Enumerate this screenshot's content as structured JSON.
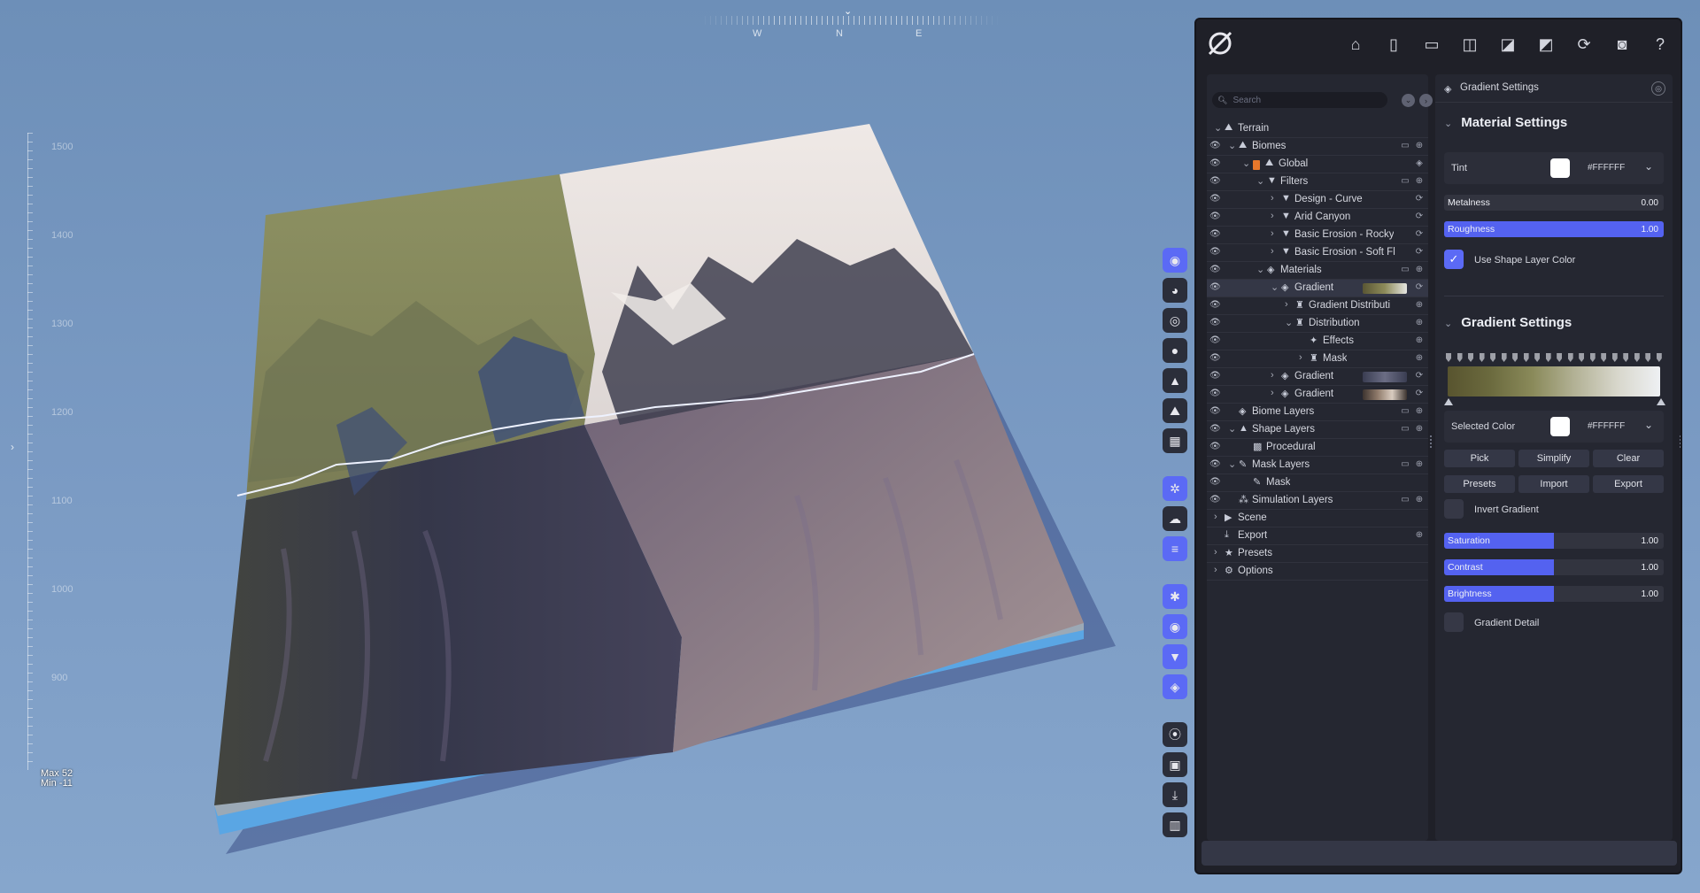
{
  "viewport": {
    "compass": {
      "pointer": "⌄",
      "west": "W",
      "north": "N",
      "east": "E"
    },
    "ruler": {
      "labels": [
        "1500",
        "1400",
        "1300",
        "1200",
        "1100",
        "1000",
        "900"
      ],
      "max_text": "Max 52",
      "min_text": "Min -11"
    },
    "left_handle": "›",
    "colors": {
      "sky": "#7b9bc4",
      "snow": "#ece7e4",
      "grass": "#8f9262",
      "rock_shadow": "#3a3b4c",
      "water_edge": "#5aa6e4"
    }
  },
  "vtoolbar": {
    "items": [
      {
        "name": "profile-icon",
        "glyph": "◉",
        "accent": true
      },
      {
        "name": "globe-icon",
        "glyph": "◕",
        "accent": false
      },
      {
        "name": "target-icon",
        "glyph": "◎",
        "accent": false
      },
      {
        "name": "water-drop-icon",
        "glyph": "●",
        "accent": false
      },
      {
        "name": "mountain-icon",
        "glyph": "▲",
        "accent": false
      },
      {
        "name": "landscape-icon",
        "glyph": "⛰",
        "accent": false
      },
      {
        "name": "grid-icon",
        "glyph": "▦",
        "accent": false
      },
      {
        "name": "snowflake-icon",
        "glyph": "✲",
        "accent": true
      },
      {
        "name": "cloud-icon",
        "glyph": "☁",
        "accent": false
      },
      {
        "name": "lines-icon",
        "glyph": "≡",
        "accent": true
      },
      {
        "name": "settings-sliders-icon",
        "glyph": "✱",
        "accent": true
      },
      {
        "name": "eye-icon",
        "glyph": "◉",
        "accent": true
      },
      {
        "name": "filter-icon",
        "glyph": "▼",
        "accent": true
      },
      {
        "name": "layers-icon",
        "glyph": "◈",
        "accent": true
      },
      {
        "name": "record-icon",
        "glyph": "⦿",
        "accent": false
      },
      {
        "name": "image-icon",
        "glyph": "▣",
        "accent": false
      },
      {
        "name": "download-icon",
        "glyph": "⤓",
        "accent": false
      },
      {
        "name": "stats-icon",
        "glyph": "▥",
        "accent": false
      }
    ]
  },
  "toolbar": {
    "icons": [
      {
        "name": "home-icon",
        "glyph": "⌂"
      },
      {
        "name": "new-file-icon",
        "glyph": "▯"
      },
      {
        "name": "open-folder-icon",
        "glyph": "▭"
      },
      {
        "name": "save-icon",
        "glyph": "◫"
      },
      {
        "name": "save-as-icon",
        "glyph": "◪"
      },
      {
        "name": "export-file-icon",
        "glyph": "◩"
      },
      {
        "name": "refresh-icon",
        "glyph": "⟳"
      },
      {
        "name": "camera-icon",
        "glyph": "◙"
      },
      {
        "name": "help-icon",
        "glyph": "?"
      }
    ]
  },
  "tree": {
    "search_placeholder": "Search",
    "search_btn_a": "⌄",
    "search_btn_b": "›",
    "rows": [
      {
        "label": "Terrain",
        "indent": 0,
        "chev": "⌄",
        "icon": "⛰",
        "eye": false,
        "a1": "",
        "a2": ""
      },
      {
        "label": "Biomes",
        "indent": 1,
        "chev": "⌄",
        "icon": "⛰",
        "eye": true,
        "a1": "▭",
        "a2": "⊕"
      },
      {
        "label": "Global",
        "indent": 2,
        "chev": "⌄",
        "icon": "⛰",
        "eye": true,
        "swatch": true,
        "a1": "",
        "a2": "◈"
      },
      {
        "label": "Filters",
        "indent": 3,
        "chev": "⌄",
        "icon": "▼",
        "eye": true,
        "a1": "▭",
        "a2": "⊕"
      },
      {
        "label": "Design - Curve",
        "indent": 4,
        "chev": "›",
        "icon": "▼",
        "eye": true,
        "a1": "",
        "a2": "⟳"
      },
      {
        "label": "Arid Canyon",
        "indent": 4,
        "chev": "›",
        "icon": "▼",
        "eye": true,
        "a1": "",
        "a2": "⟳"
      },
      {
        "label": "Basic Erosion - Rocky",
        "indent": 4,
        "chev": "›",
        "icon": "▼",
        "eye": true,
        "a1": "",
        "a2": "⟳"
      },
      {
        "label": "Basic Erosion - Soft Fl",
        "indent": 4,
        "chev": "›",
        "icon": "▼",
        "eye": true,
        "a1": "",
        "a2": "⟳"
      },
      {
        "label": "Materials",
        "indent": 3,
        "chev": "⌄",
        "icon": "◈",
        "eye": true,
        "a1": "▭",
        "a2": "⊕"
      },
      {
        "label": "Gradient",
        "indent": 4,
        "chev": "⌄",
        "icon": "◈",
        "eye": true,
        "sel": true,
        "grad": "linear-gradient(90deg,#5a5634,#8d8b5a,#e6e6e2)",
        "a1": "",
        "a2": "⟳"
      },
      {
        "label": "Gradient Distributi",
        "indent": 5,
        "chev": "›",
        "icon": "♜",
        "eye": true,
        "a1": "",
        "a2": "⊕"
      },
      {
        "label": "Distribution",
        "indent": 5,
        "chev": "⌄",
        "icon": "♜",
        "eye": true,
        "a1": "",
        "a2": "⊕"
      },
      {
        "label": "Effects",
        "indent": 6,
        "chev": "",
        "icon": "✦",
        "eye": true,
        "a1": "",
        "a2": "⊕"
      },
      {
        "label": "Mask",
        "indent": 6,
        "chev": "›",
        "icon": "♜",
        "eye": true,
        "a1": "",
        "a2": "⊕"
      },
      {
        "label": "Gradient",
        "indent": 4,
        "chev": "›",
        "icon": "◈",
        "eye": true,
        "grad": "linear-gradient(90deg,#3a3d52,#6b6d84,#3a3d52)",
        "a1": "",
        "a2": "⟳"
      },
      {
        "label": "Gradient",
        "indent": 4,
        "chev": "›",
        "icon": "◈",
        "eye": true,
        "grad": "linear-gradient(90deg,#3d3430,#8f7a6a,#d9ccc0,#3d3430)",
        "a1": "",
        "a2": "⟳"
      },
      {
        "label": "Biome Layers",
        "indent": 1,
        "chev": "",
        "icon": "◈",
        "eye": true,
        "a1": "▭",
        "a2": "⊕"
      },
      {
        "label": "Shape Layers",
        "indent": 1,
        "chev": "⌄",
        "icon": "▲",
        "eye": true,
        "a1": "▭",
        "a2": "⊕"
      },
      {
        "label": "Procedural",
        "indent": 2,
        "chev": "",
        "icon": "▩",
        "eye": true,
        "a1": "",
        "a2": ""
      },
      {
        "label": "Mask Layers",
        "indent": 1,
        "chev": "⌄",
        "icon": "✎",
        "eye": true,
        "a1": "▭",
        "a2": "⊕"
      },
      {
        "label": "Mask",
        "indent": 2,
        "chev": "",
        "icon": "✎",
        "eye": true,
        "a1": "",
        "a2": ""
      },
      {
        "label": "Simulation Layers",
        "indent": 1,
        "chev": "",
        "icon": "⁂",
        "eye": true,
        "a1": "▭",
        "a2": "⊕"
      },
      {
        "label": "Scene",
        "indent": 0,
        "chev": "›",
        "icon": "▶",
        "eye": false,
        "a1": "",
        "a2": ""
      },
      {
        "label": "Export",
        "indent": 0,
        "chev": "",
        "icon": "⤓",
        "eye": false,
        "a1": "",
        "a2": "⊕"
      },
      {
        "label": "Presets",
        "indent": 0,
        "chev": "›",
        "icon": "★",
        "eye": false,
        "a1": "",
        "a2": ""
      },
      {
        "label": "Options",
        "indent": 0,
        "chev": "›",
        "icon": "⚙",
        "eye": false,
        "a1": "",
        "a2": ""
      }
    ]
  },
  "settings": {
    "header_title": "Gradient Settings",
    "header_icon": "◈",
    "header_btn": "◎",
    "material": {
      "title": "Material Settings",
      "chev": "⌄",
      "tint_label": "Tint",
      "tint_hex": "#FFFFFF",
      "tint_color": "#FFFFFF",
      "dropdown": "⌄",
      "metalness_label": "Metalness",
      "metalness_value": "0.00",
      "metalness_fraction": 0.0,
      "roughness_label": "Roughness",
      "roughness_value": "1.00",
      "roughness_fraction": 1.0,
      "use_shape_label": "Use Shape Layer Color",
      "use_shape_checked": "✓"
    },
    "gradient": {
      "title": "Gradient Settings",
      "chev": "⌄",
      "stops_count": 20,
      "colors": [
        "#58542f",
        "#6b6a3e",
        "#8a8a5a",
        "#b3b296",
        "#d8d7cc",
        "#eef0f3"
      ],
      "selected_label": "Selected Color",
      "selected_hex": "#FFFFFF",
      "dropdown": "⌄",
      "buttons_row1": [
        "Pick",
        "Simplify",
        "Clear"
      ],
      "buttons_row2": [
        "Presets",
        "Import",
        "Export"
      ],
      "invert_label": "Invert Gradient",
      "saturation_label": "Saturation",
      "saturation_value": "1.00",
      "saturation_fraction": 0.5,
      "contrast_label": "Contrast",
      "contrast_value": "1.00",
      "contrast_fraction": 0.5,
      "brightness_label": "Brightness",
      "brightness_value": "1.00",
      "brightness_fraction": 0.5,
      "detail_label": "Gradient Detail"
    }
  }
}
